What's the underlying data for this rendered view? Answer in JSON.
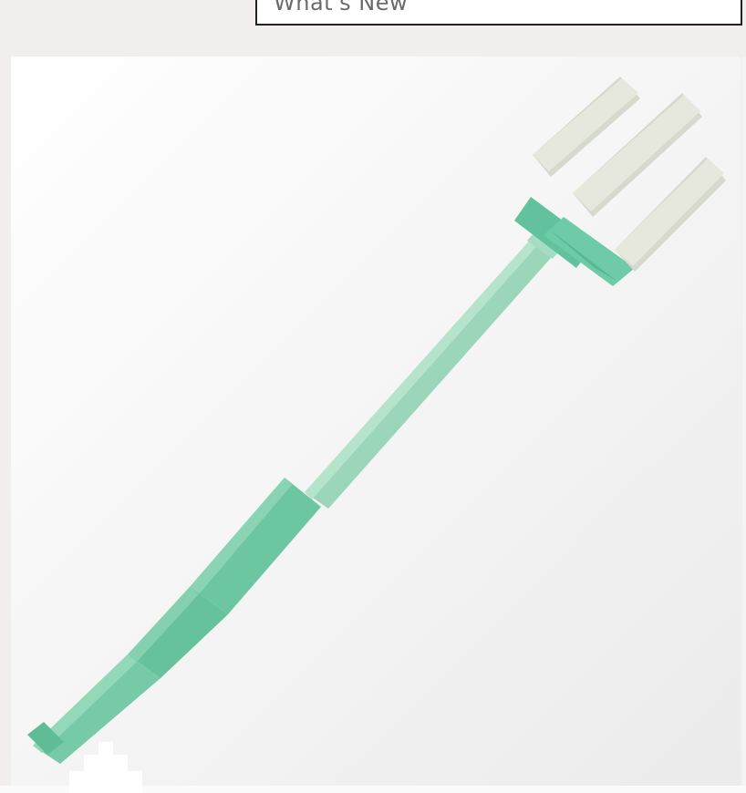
{
  "header": {
    "whats_new_label": "What's New"
  },
  "product_image": {
    "subject": "trident-icon",
    "shaft_color": "#8fd1b3",
    "grip_color": "#6cc7a4",
    "prong_color": "#d8dbd0"
  },
  "colors": {
    "page_background": "#f1eeed",
    "frame_border": "#222222",
    "label_text": "#6b6b6b"
  }
}
